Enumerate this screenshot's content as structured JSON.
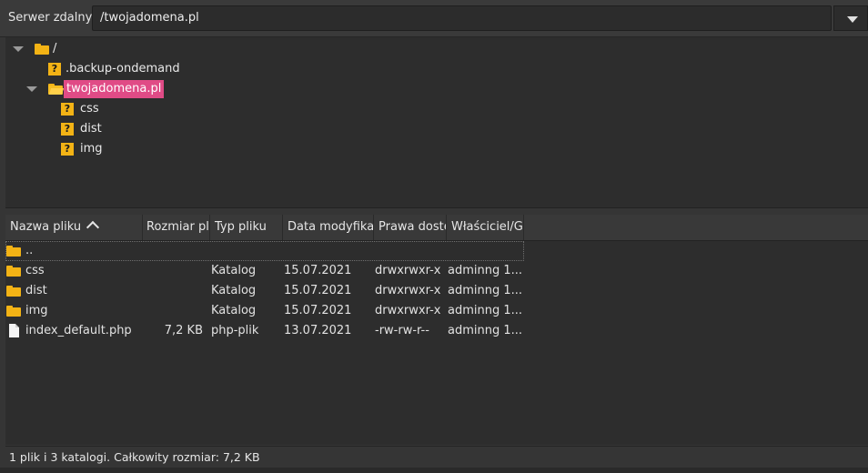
{
  "path_bar": {
    "label": "Serwer zdalny:",
    "value": "/twojadomena.pl"
  },
  "tree": {
    "root_label": "/",
    "items": [
      {
        "label": ".backup-ondemand",
        "icon": "unknown-folder-icon"
      },
      {
        "label": "twojadomena.pl",
        "icon": "folder-open-icon",
        "selected": true
      },
      {
        "label": "css",
        "icon": "unknown-folder-icon"
      },
      {
        "label": "dist",
        "icon": "unknown-folder-icon"
      },
      {
        "label": "img",
        "icon": "unknown-folder-icon"
      }
    ],
    "unknown_glyph": "?"
  },
  "list": {
    "columns": [
      "Nazwa pliku",
      "Rozmiar plik",
      "Typ pliku",
      "Data modyfikac",
      "Prawa dostę",
      "Właściciel/Gru"
    ],
    "parent_row": "..",
    "rows": [
      {
        "name": "css",
        "size": "",
        "type": "Katalog",
        "date": "15.07.2021",
        "perms": "drwxrwxr-x",
        "owner": "adminng 1..."
      },
      {
        "name": "dist",
        "size": "",
        "type": "Katalog",
        "date": "15.07.2021",
        "perms": "drwxrwxr-x",
        "owner": "adminng 1..."
      },
      {
        "name": "img",
        "size": "",
        "type": "Katalog",
        "date": "15.07.2021",
        "perms": "drwxrwxr-x",
        "owner": "adminng 1..."
      },
      {
        "name": "index_default.php",
        "size": "7,2 KB",
        "type": "php-plik",
        "date": "13.07.2021",
        "perms": "-rw-rw-r--",
        "owner": "adminng 1..."
      }
    ]
  },
  "status": "1 plik i 3 katalogi. Całkowity rozmiar: 7,2 KB",
  "colors": {
    "selection": "#e04b86",
    "folder": "#f3b315",
    "background": "#2d2d2d"
  }
}
